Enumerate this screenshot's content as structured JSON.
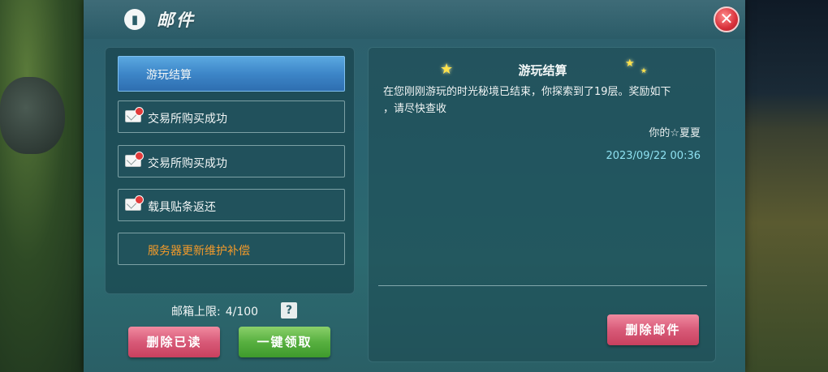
{
  "window": {
    "title": "邮件",
    "title_icon": "mail-book-icon",
    "close_glyph": "✕"
  },
  "mail_list": [
    {
      "label": "游玩结算",
      "active": true,
      "has_icon": false,
      "color": "#ffffff"
    },
    {
      "label": "交易所购买成功",
      "active": false,
      "has_icon": true,
      "color": "#ffffff"
    },
    {
      "label": "交易所购买成功",
      "active": false,
      "has_icon": true,
      "color": "#ffffff"
    },
    {
      "label": "载具贴条返还",
      "active": false,
      "has_icon": true,
      "color": "#ffffff"
    },
    {
      "label": "服务器更新维护补偿",
      "active": false,
      "has_icon": false,
      "color": "#f39a2a"
    }
  ],
  "capacity": {
    "label": "邮箱上限:",
    "value": "4/100",
    "help_glyph": "?"
  },
  "buttons": {
    "delete_read": "删除已读",
    "claim_all": "一键领取",
    "delete_mail": "删除邮件"
  },
  "detail": {
    "title": "游玩结算",
    "body_line1": "在您刚刚游玩的时光秘境已结束，你探索到了19层。奖励如下",
    "body_line2": "，请尽快查收",
    "sender": "你的☆夏夏",
    "datetime": "2023/09/22 00:36"
  },
  "colors": {
    "accent_blue": "#3d86c8",
    "delete_red": "#d85a78",
    "claim_green": "#58b040",
    "date_cyan": "#8ee0f0"
  }
}
